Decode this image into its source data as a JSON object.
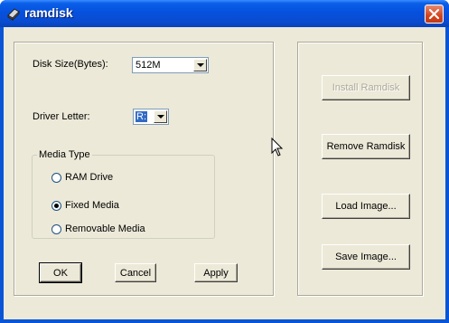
{
  "window": {
    "title": "ramdisk"
  },
  "left_panel": {
    "disk_size_label": "Disk Size(Bytes):",
    "disk_size_value": "512M",
    "driver_letter_label": "Driver Letter:",
    "driver_letter_value": "R:",
    "media_type": {
      "label": "Media Type",
      "options": [
        {
          "label": "RAM Drive",
          "selected": false
        },
        {
          "label": "Fixed Media",
          "selected": true
        },
        {
          "label": "Removable Media",
          "selected": false
        }
      ]
    },
    "buttons": {
      "ok": "OK",
      "cancel": "Cancel",
      "apply": "Apply"
    }
  },
  "right_panel": {
    "buttons": {
      "install": {
        "label": "Install Ramdisk",
        "enabled": false
      },
      "remove": {
        "label": "Remove Ramdisk",
        "enabled": true
      },
      "load": {
        "label": "Load Image...",
        "enabled": true
      },
      "save": {
        "label": "Save Image...",
        "enabled": true
      }
    }
  },
  "icons": [
    "app-icon",
    "close-icon",
    "dropdown-arrow-icon",
    "mouse-cursor-icon"
  ]
}
